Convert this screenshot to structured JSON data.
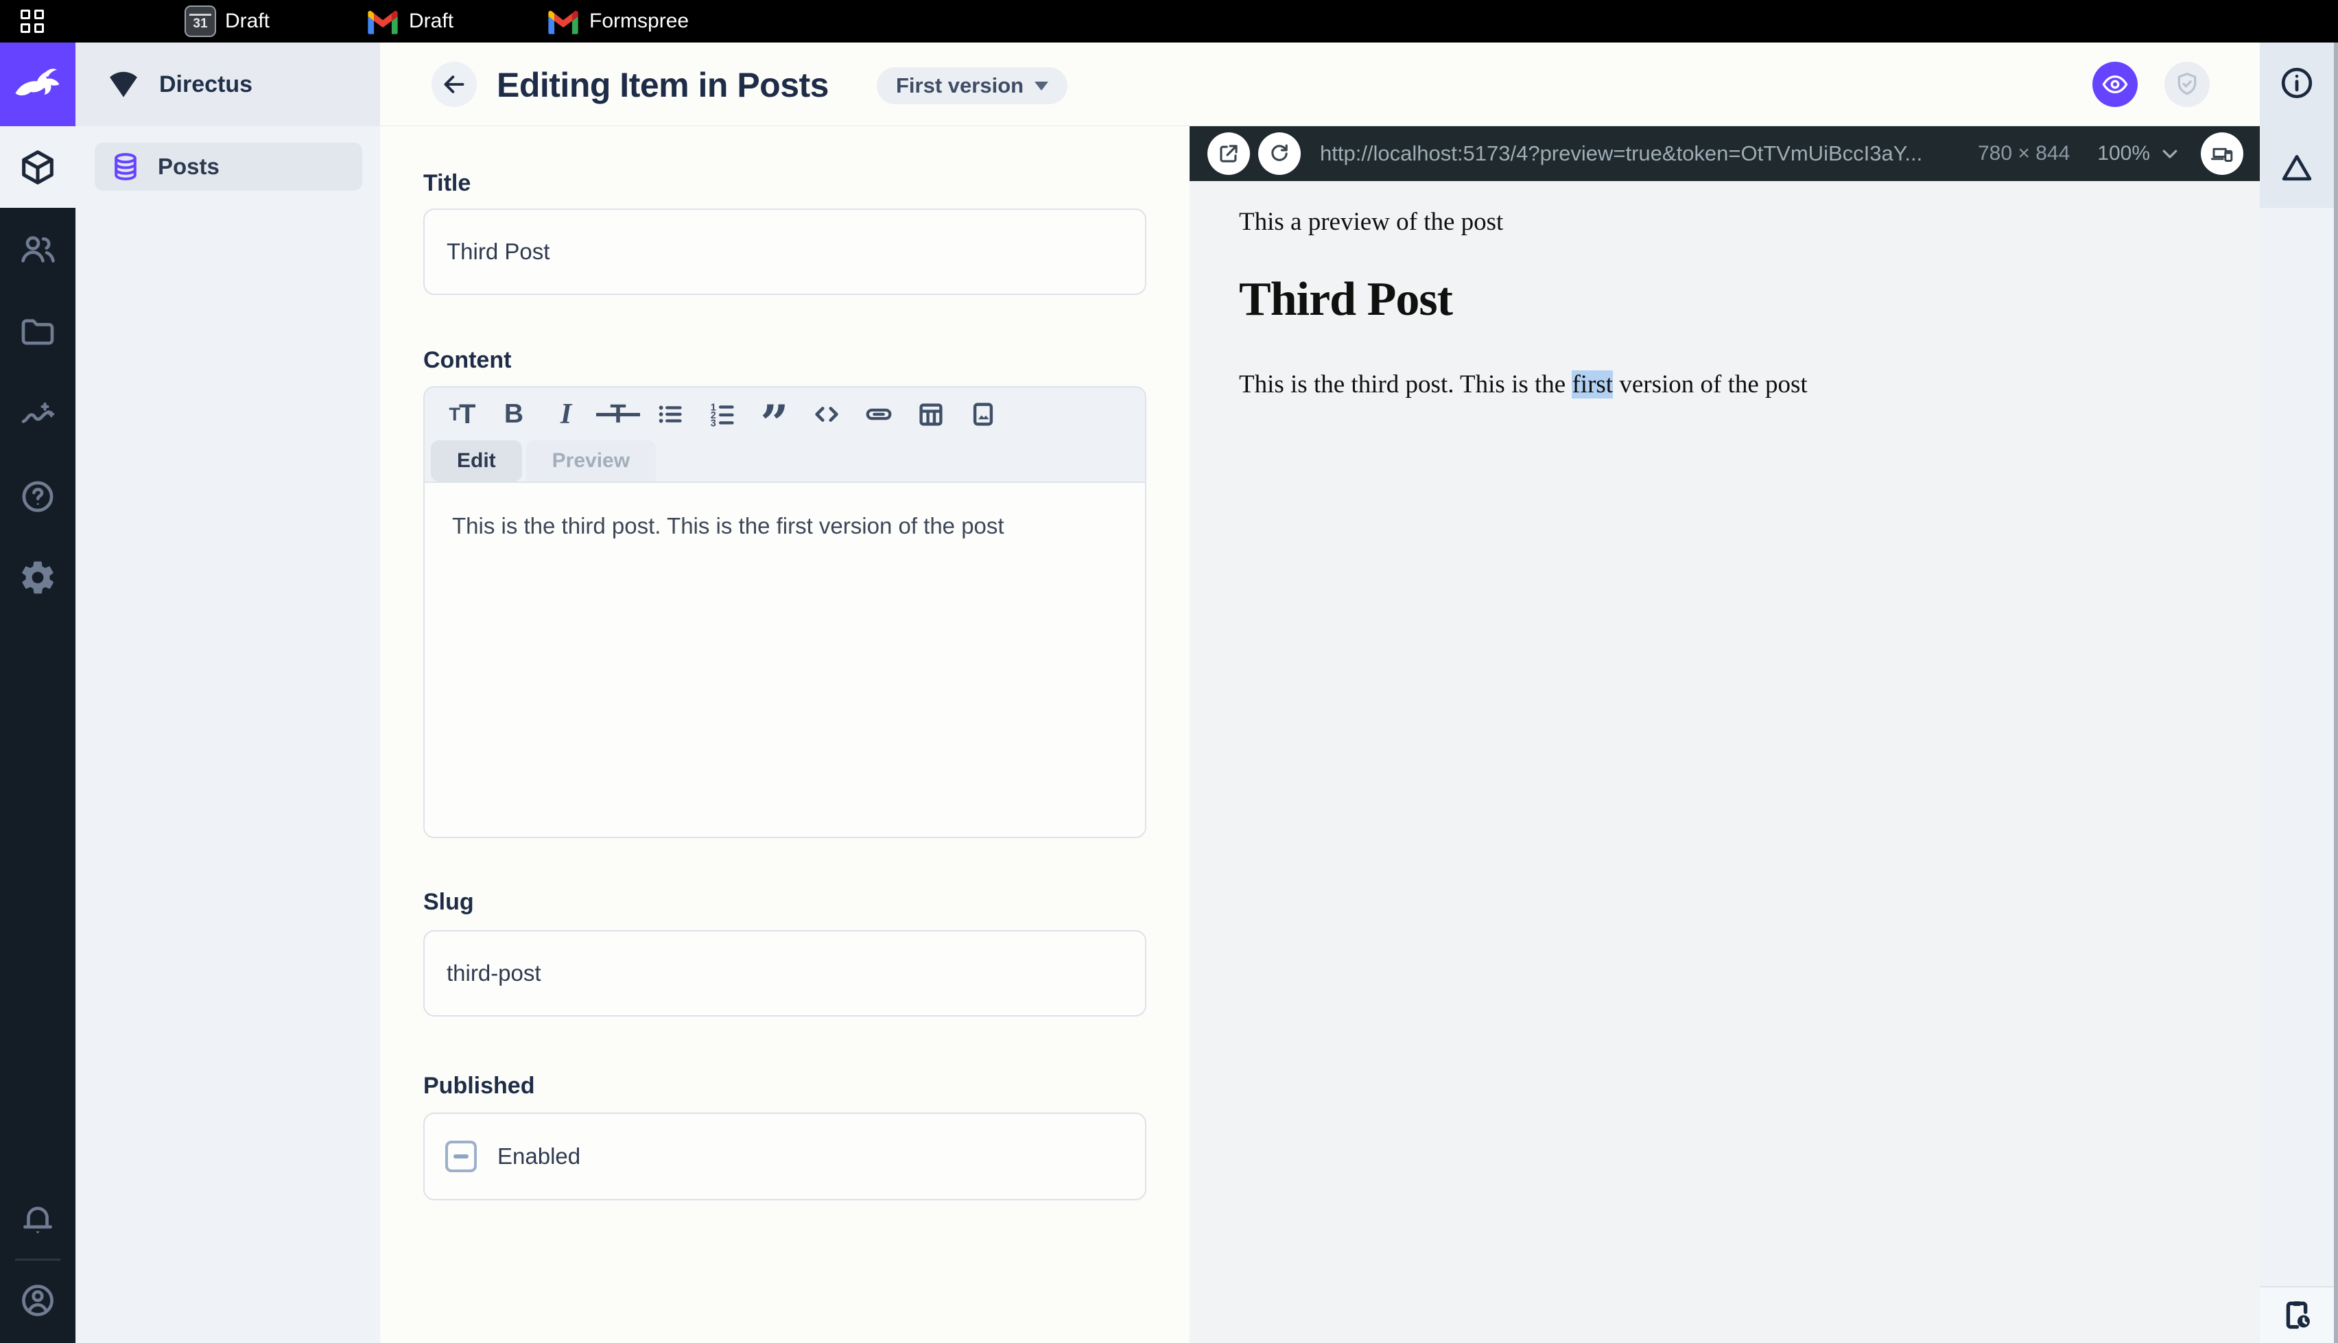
{
  "topbar": {
    "tabs": [
      {
        "icon": "calendar-icon",
        "label": "Draft"
      },
      {
        "icon": "gmail-icon",
        "label": "Draft"
      },
      {
        "icon": "gmail-icon",
        "label": "Formspree"
      }
    ]
  },
  "module_rail": {
    "modules": [
      "directus-logo",
      "content",
      "users",
      "files",
      "insights",
      "help",
      "settings",
      "notifications",
      "account"
    ]
  },
  "nav": {
    "project_name": "Directus",
    "items": [
      {
        "icon": "database-icon",
        "label": "Posts",
        "active": true
      }
    ]
  },
  "header": {
    "title": "Editing Item in Posts",
    "version_label": "First version"
  },
  "form": {
    "title": {
      "label": "Title",
      "value": "Third Post"
    },
    "content": {
      "label": "Content",
      "toolbar_icons": [
        "format-size",
        "bold",
        "italic",
        "strikethrough",
        "bulleted-list",
        "numbered-list",
        "blockquote",
        "code",
        "link",
        "table",
        "image"
      ],
      "tabs": {
        "edit": "Edit",
        "preview": "Preview"
      },
      "active_tab": "Edit",
      "value": "This is the third post. This is the first version of the post"
    },
    "slug": {
      "label": "Slug",
      "value": "third-post"
    },
    "published": {
      "label": "Published",
      "checkbox_label": "Enabled",
      "checkbox_state": "indeterminate"
    }
  },
  "preview_pane": {
    "url": "http://localhost:5173/4?preview=true&token=OtTVmUiBccI3aY...",
    "dimensions": "780 × 844",
    "zoom_level": "100%",
    "content": {
      "intro": "This a preview of the post",
      "heading": "Third Post",
      "paragraph_before": "This is the third post. This is the ",
      "highlighted_word": "first",
      "paragraph_after": " version of the post"
    }
  },
  "colors": {
    "accent": "#6644ff",
    "topbar": "#000000",
    "module_rail": "#141c26",
    "url_bar": "#1f292e",
    "selection_highlight": "#b3d1f3"
  }
}
